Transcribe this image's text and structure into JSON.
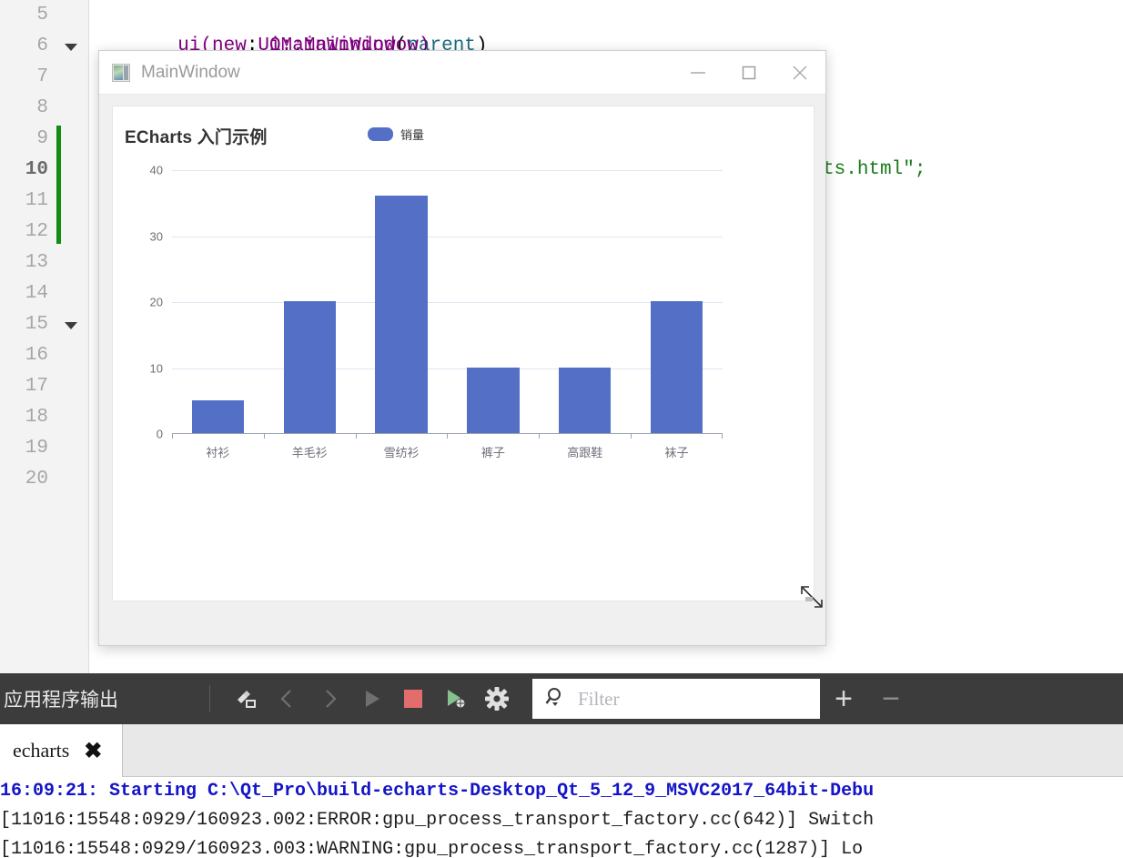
{
  "editor": {
    "line_numbers": [
      "5",
      "6",
      "7",
      "8",
      "9",
      "10",
      "11",
      "12",
      "13",
      "14",
      "15",
      "16",
      "17",
      "18",
      "19",
      "20"
    ],
    "current_line": "10",
    "fold_lines": [
      "6",
      "15"
    ],
    "code_line_5": ": QMainWindow(parent)",
    "code_line_5_punc": ": ",
    "code_line_5_type": "QMainWindow",
    "code_line_5_open": "(",
    "code_line_5_param": "parent",
    "code_line_5_close": ")",
    "code_line_6": "  ui(new Ui::MainWindow)",
    "code_line_10_tail": "urce/echarts.html\";"
  },
  "app_window": {
    "title": "MainWindow",
    "icon": "app-window-icon",
    "minimize_label": "—",
    "maximize_label": "□",
    "close_label": "✕"
  },
  "chart_data": {
    "type": "bar",
    "title": "ECharts 入门示例",
    "xlabel": "",
    "ylabel": "",
    "ylim": [
      0,
      40
    ],
    "yticks": [
      "40",
      "30",
      "20",
      "10",
      "0"
    ],
    "grid": true,
    "legend_position": "top-center",
    "legend": [
      "销量"
    ],
    "series_color": "#5470c6",
    "categories": [
      "衬衫",
      "羊毛衫",
      "雪纺衫",
      "裤子",
      "高跟鞋",
      "袜子"
    ],
    "series": [
      {
        "name": "销量",
        "values": [
          5,
          20,
          36,
          10,
          10,
          20
        ]
      }
    ]
  },
  "output_pane": {
    "title": "应用程序输出",
    "toolbar_icons": [
      "clear-output-icon",
      "prev-item-icon",
      "next-item-icon",
      "run-icon",
      "stop-icon",
      "debug-run-icon",
      "settings-gear-icon"
    ],
    "filter": {
      "placeholder": "Filter",
      "value": "",
      "icon": "search-icon"
    },
    "zoom_in_label": "+",
    "zoom_out_label": "−",
    "tabs": [
      {
        "label": "echarts",
        "close": "✖"
      }
    ],
    "console_lines": [
      "16:09:21: Starting C:\\Qt_Pro\\build-echarts-Desktop_Qt_5_12_9_MSVC2017_64bit-Debu",
      "[11016:15548:0929/160923.002:ERROR:gpu_process_transport_factory.cc(642)] Switch",
      "[11016:15548:0929/160923.003:WARNING:gpu_process_transport_factory.cc(1287)] Lo"
    ]
  },
  "colors": {
    "bar": "#5470c6",
    "gridline": "#e0e6f1",
    "axis": "#9aa3b0",
    "tick_text": "#6e7079",
    "console_start": "#1414c8",
    "change_marker": "#128c12",
    "toolbar_bg": "#3c3c3c"
  }
}
